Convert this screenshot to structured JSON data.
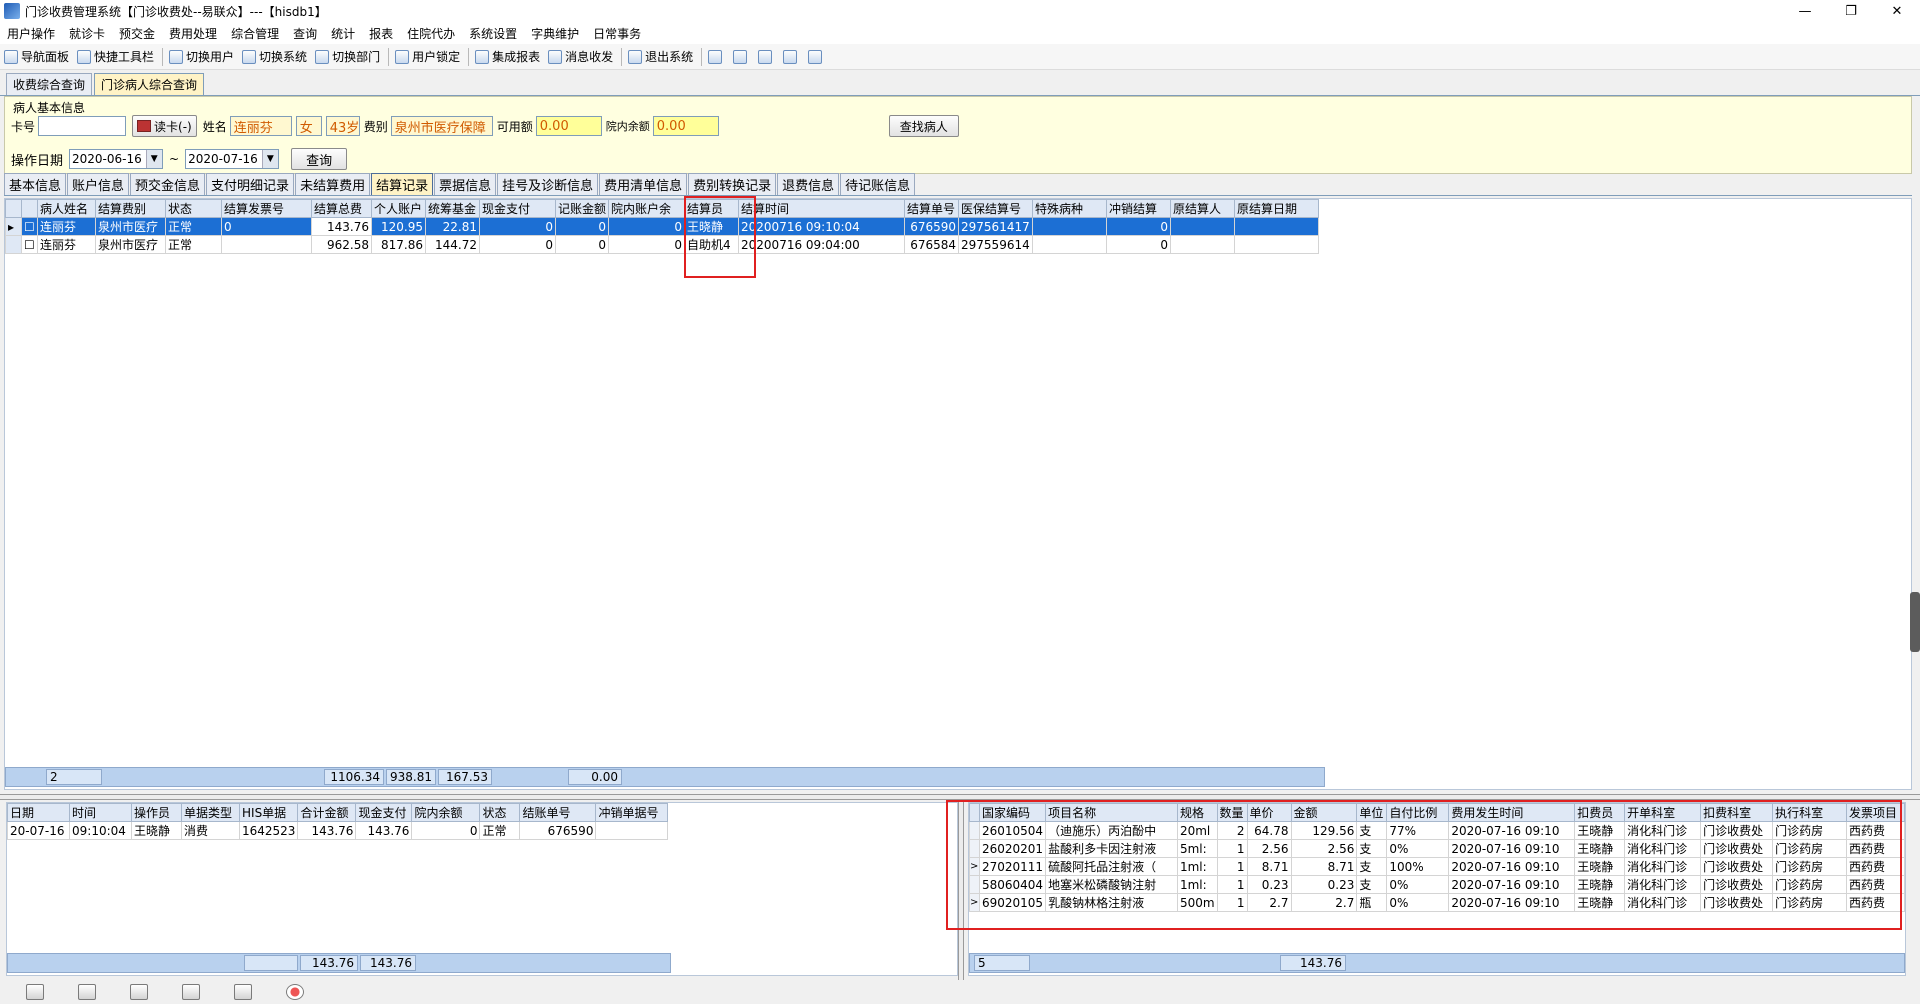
{
  "window": {
    "title": "门诊收费管理系统【门诊收费处--易联众】---【hisdb1】",
    "buttons": [
      "—",
      "❐",
      "✕"
    ]
  },
  "menu": [
    "用户操作",
    "就诊卡",
    "预交金",
    "费用处理",
    "综合管理",
    "查询",
    "统计",
    "报表",
    "住院代办",
    "系统设置",
    "字典维护",
    "日常事务"
  ],
  "toolbar": [
    "导航面板",
    "快捷工具栏",
    "切换用户",
    "切换系统",
    "切换部门",
    "用户锁定",
    "集成报表",
    "消息收发",
    "退出系统"
  ],
  "doc_tabs": [
    {
      "label": "收费综合查询",
      "active": false
    },
    {
      "label": "门诊病人综合查询",
      "active": true
    }
  ],
  "patient_panel": {
    "legend": "病人基本信息",
    "card_label": "卡号",
    "card_value": "",
    "read_card_label": "读卡(-)",
    "name_label": "姓名",
    "name_value": "连丽芬",
    "gender_value": "女",
    "age_value": "43岁",
    "fee_type_label": "费别",
    "fee_type_value": "泉州市医疗保障",
    "available_label": "可用额",
    "available_value": "0.00",
    "balance_label": "院内余额",
    "balance_value": "0.00",
    "find_button": "查找病人",
    "op_date_label": "操作日期",
    "date_from": "2020-06-16",
    "date_sep": "~",
    "date_to": "2020-07-16",
    "query_button": "查询"
  },
  "sub_tabs": [
    {
      "label": "基本信息",
      "active": false
    },
    {
      "label": "账户信息",
      "active": false
    },
    {
      "label": "预交金信息",
      "active": false
    },
    {
      "label": "支付明细记录",
      "active": false
    },
    {
      "label": "未结算费用",
      "active": false
    },
    {
      "label": "结算记录",
      "active": true
    },
    {
      "label": "票据信息",
      "active": false
    },
    {
      "label": "挂号及诊断信息",
      "active": false
    },
    {
      "label": "费用清单信息",
      "active": false
    },
    {
      "label": "费别转换记录",
      "active": false
    },
    {
      "label": "退费信息",
      "active": false
    },
    {
      "label": "待记账信息",
      "active": false
    }
  ],
  "settle_table": {
    "headers": [
      "",
      "",
      "病人姓名",
      "结算费别",
      "状态",
      "结算发票号",
      "结算总费",
      "个人账户",
      "统筹基金",
      "现金支付",
      "记账金额",
      "院内账户余",
      "结算员",
      "结算时间",
      "结算单号",
      "医保结算号",
      "特殊病种",
      "冲销结算",
      "原结算人",
      "原结算日期"
    ],
    "rows": [
      [
        "▸",
        "☐",
        "连丽芬",
        "泉州市医疗",
        "正常",
        "0",
        "143.76",
        "120.95",
        "22.81",
        "0",
        "0",
        "0",
        "王晓静",
        "20200716 09:10:04",
        "676590",
        "297561417",
        "",
        "0",
        "",
        ""
      ],
      [
        "",
        "☐",
        "连丽芬",
        "泉州市医疗",
        "正常",
        "",
        "962.58",
        "817.86",
        "144.72",
        "0",
        "0",
        "0",
        "自助机4",
        "20200716 09:04:00",
        "676584",
        "297559614",
        "",
        "0",
        "",
        ""
      ]
    ],
    "summary": {
      "count": "2",
      "total": "1106.34",
      "personal": "938.81",
      "pool": "167.53",
      "bookkeep": "0.00"
    }
  },
  "payment_table": {
    "headers": [
      "日期",
      "时间",
      "操作员",
      "单据类型",
      "HIS单据",
      "合计金额",
      "现金支付",
      "院内余额",
      "状态",
      "结账单号",
      "冲销单据号"
    ],
    "rows": [
      [
        "20-07-16",
        "09:10:04",
        "王晓静",
        "消费",
        "1642523",
        "143.76",
        "143.76",
        "0",
        "正常",
        "676590",
        ""
      ]
    ],
    "summary": {
      "total": "143.76",
      "cash": "143.76"
    }
  },
  "detail_table": {
    "headers": [
      "",
      "国家编码",
      "项目名称",
      "规格",
      "数量",
      "单价",
      "金额",
      "单位",
      "自付比例",
      "费用发生时间",
      "扣费员",
      "开单科室",
      "扣费科室",
      "执行科室",
      "发票项目"
    ],
    "rows": [
      [
        "",
        "26010504",
        "（迪施乐）丙泊酚中",
        "20ml",
        "2",
        "64.78",
        "129.56",
        "支",
        "77%",
        "2020-07-16 09:10",
        "王晓静",
        "消化科门诊",
        "门诊收费处",
        "门诊药房",
        "西药费"
      ],
      [
        "",
        "26020201",
        "盐酸利多卡因注射液",
        "5ml:",
        "1",
        "2.56",
        "2.56",
        "支",
        "0%",
        "2020-07-16 09:10",
        "王晓静",
        "消化科门诊",
        "门诊收费处",
        "门诊药房",
        "西药费"
      ],
      [
        ">",
        "27020111",
        "硫酸阿托品注射液（",
        "1ml:",
        "1",
        "8.71",
        "8.71",
        "支",
        "100%",
        "2020-07-16 09:10",
        "王晓静",
        "消化科门诊",
        "门诊收费处",
        "门诊药房",
        "西药费"
      ],
      [
        "",
        "58060404",
        "地塞米松磷酸钠注射",
        "1ml:",
        "1",
        "0.23",
        "0.23",
        "支",
        "0%",
        "2020-07-16 09:10",
        "王晓静",
        "消化科门诊",
        "门诊收费处",
        "门诊药房",
        "西药费"
      ],
      [
        ">",
        "69020105",
        "乳酸钠林格注射液",
        "500m",
        "1",
        "2.7",
        "2.7",
        "瓶",
        "0%",
        "2020-07-16 09:10",
        "王晓静",
        "消化科门诊",
        "门诊收费处",
        "门诊药房",
        "西药费"
      ]
    ],
    "summary": {
      "count": "5",
      "total": "143.76"
    }
  },
  "colors": {
    "highlight_red": "#e02020",
    "selected_row": "#1c6fd4",
    "panel_yellow": "#ffffe0"
  }
}
